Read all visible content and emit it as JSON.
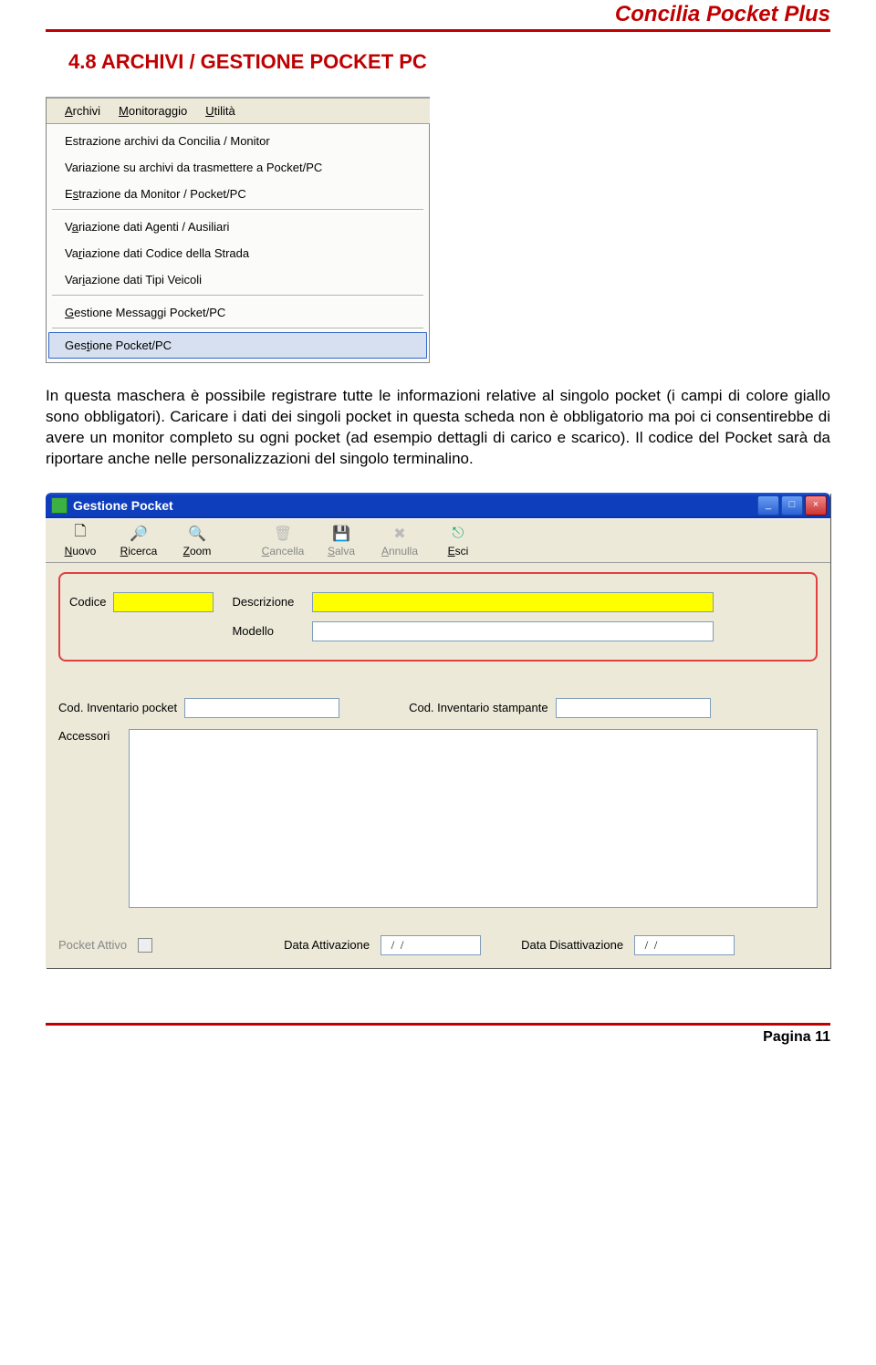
{
  "header": {
    "title": "Concilia Pocket Plus"
  },
  "section": {
    "title": "4.8  ARCHIVI / GESTIONE POCKET PC"
  },
  "menu": {
    "bar": {
      "archivi": "Archivi",
      "monitoraggio": "Monitoraggio",
      "utilita": "Utilità"
    },
    "items": {
      "i0": "Estrazione archivi da Concilia / Monitor",
      "i1": "Variazione su archivi da trasmettere a Pocket/PC",
      "i2": "Estrazione da Monitor / Pocket/PC",
      "i3": "Variazione dati Agenti / Ausiliari",
      "i4": "Variazione dati Codice della Strada",
      "i5": "Variazione dati Tipi Veicoli",
      "i6": "Gestione Messaggi Pocket/PC",
      "i7": "Gestione Pocket/PC"
    }
  },
  "paragraph": "In questa maschera è possibile registrare tutte le informazioni relative al singolo pocket (i campi di colore giallo sono obbligatori). Caricare i dati dei singoli pocket in questa scheda non è obbligatorio ma poi ci consentirebbe di avere un monitor completo su ogni pocket  (ad esempio dettagli di carico e scarico). Il codice del Pocket sarà da riportare anche nelle personalizzazioni del singolo terminalino.",
  "window": {
    "title": "Gestione Pocket",
    "toolbar": {
      "nuovo": "Nuovo",
      "ricerca": "Ricerca",
      "zoom": "Zoom",
      "cancella": "Cancella",
      "salva": "Salva",
      "annulla": "Annulla",
      "esci": "Esci"
    },
    "labels": {
      "codice": "Codice",
      "descrizione": "Descrizione",
      "modello": "Modello",
      "cod_inv_pocket": "Cod. Inventario pocket",
      "cod_inv_stamp": "Cod. Inventario stampante",
      "accessori": "Accessori",
      "pocket_attivo": "Pocket Attivo",
      "data_att": "Data Attivazione",
      "data_dis": "Data Disattivazione"
    },
    "values": {
      "codice": "",
      "descrizione": "",
      "modello": "",
      "cod_inv_pocket": "",
      "cod_inv_stamp": "",
      "accessori": "",
      "data_att": "  /  /",
      "data_dis": "  /  /"
    }
  },
  "footer": {
    "text": "Pagina 11"
  }
}
